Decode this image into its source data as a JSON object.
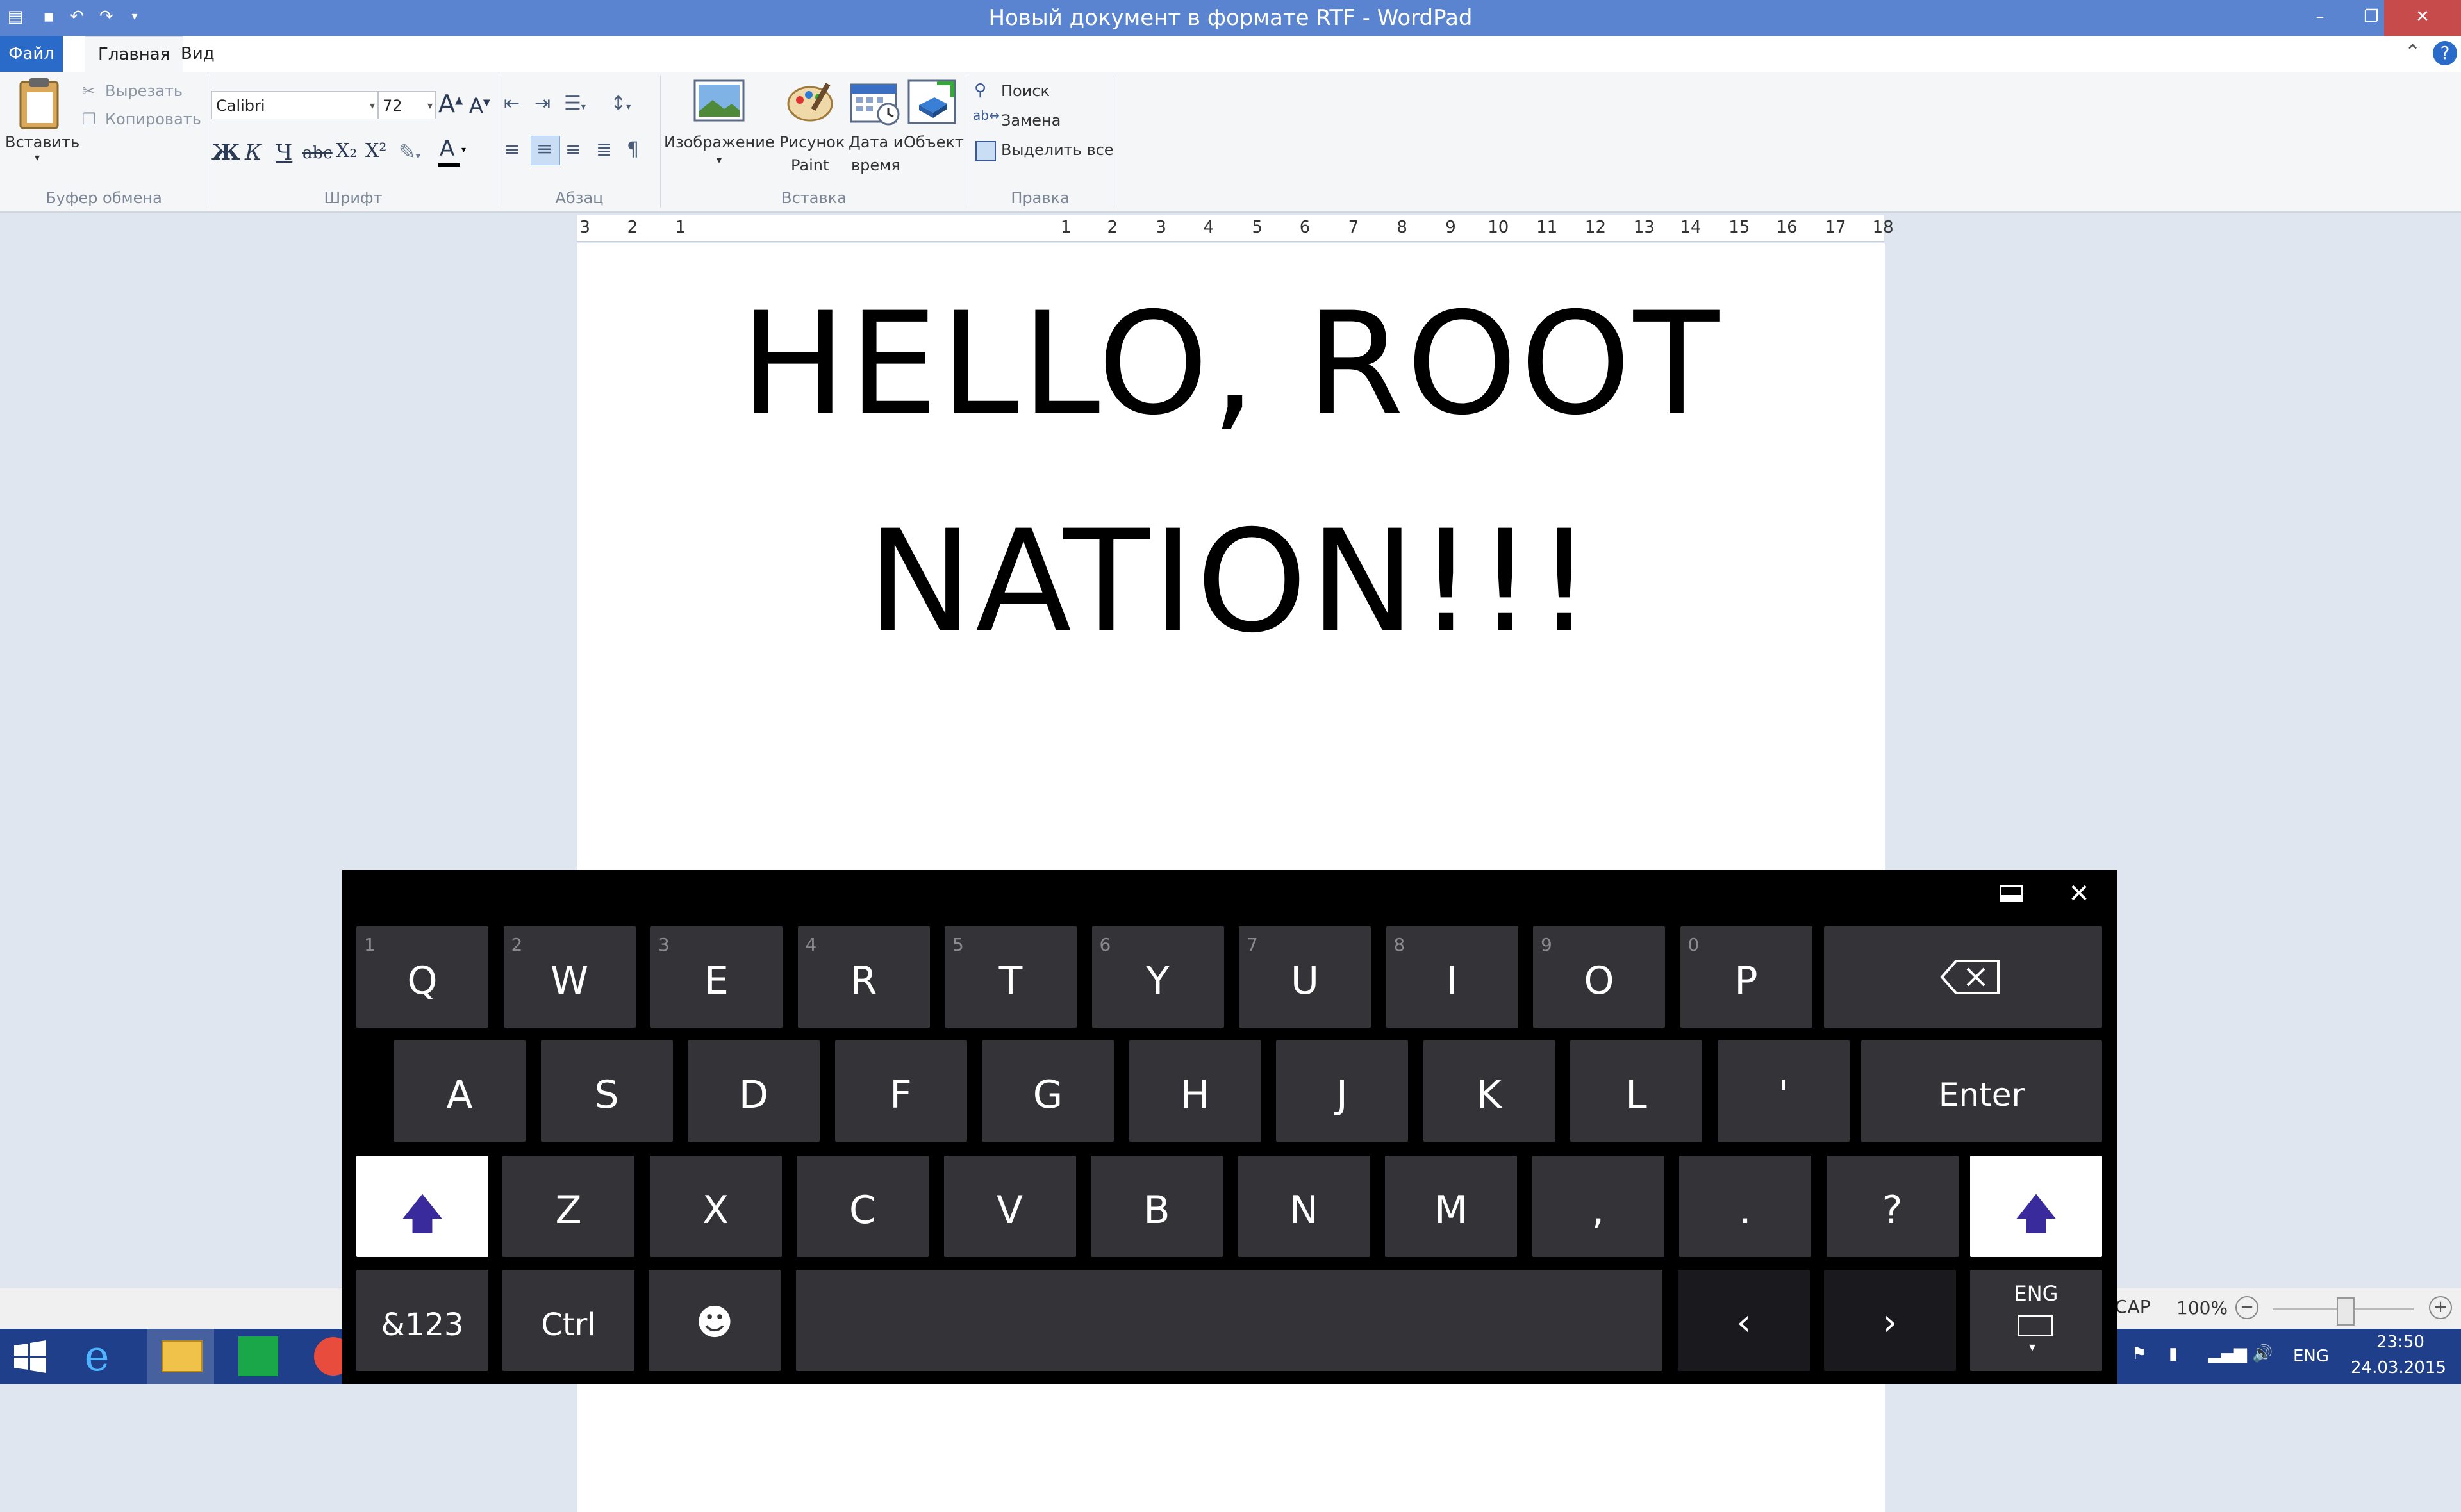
{
  "window": {
    "title": "Новый документ в формате RTF - WordPad"
  },
  "tabs": {
    "file": "Файл",
    "home": "Главная",
    "view": "Вид"
  },
  "clipboard": {
    "paste": "Вставить",
    "cut": "Вырезать",
    "copy": "Копировать",
    "group": "Буфер обмена"
  },
  "font": {
    "name": "Calibri",
    "size": "72",
    "group": "Шрифт",
    "bold": "Ж",
    "italic": "К",
    "underline": "Ч",
    "strike": "abc",
    "subscript": "X₂",
    "superscript": "X²"
  },
  "paragraph": {
    "group": "Абзац"
  },
  "insert": {
    "image": "Изображение",
    "paint1": "Рисунок",
    "paint2": "Paint",
    "datetime1": "Дата и",
    "datetime2": "время",
    "object": "Объект",
    "group": "Вставка"
  },
  "editing": {
    "find": "Поиск",
    "replace": "Замена",
    "select_all": "Выделить все",
    "group": "Правка"
  },
  "ruler": {
    "ticks": [
      "3",
      "2",
      "1",
      "1",
      "2",
      "3",
      "4",
      "5",
      "6",
      "7",
      "8",
      "9",
      "10",
      "11",
      "12",
      "13",
      "14",
      "15",
      "16",
      "17",
      "18"
    ]
  },
  "document": {
    "line1": "HELLO, ROOT",
    "line2": "NATION!!!"
  },
  "status": {
    "caps": "CAP",
    "zoom": "100%"
  },
  "tray": {
    "lang": "ENG",
    "time": "23:50",
    "date": "24.03.2015"
  },
  "keyboard": {
    "row1": [
      {
        "label": "Q",
        "num": "1"
      },
      {
        "label": "W",
        "num": "2"
      },
      {
        "label": "E",
        "num": "3"
      },
      {
        "label": "R",
        "num": "4"
      },
      {
        "label": "T",
        "num": "5"
      },
      {
        "label": "Y",
        "num": "6"
      },
      {
        "label": "U",
        "num": "7"
      },
      {
        "label": "I",
        "num": "8"
      },
      {
        "label": "O",
        "num": "9"
      },
      {
        "label": "P",
        "num": "0"
      }
    ],
    "row2": [
      "A",
      "S",
      "D",
      "F",
      "G",
      "H",
      "J",
      "K",
      "L",
      "'"
    ],
    "row3": [
      "Z",
      "X",
      "C",
      "V",
      "B",
      "N",
      "M",
      ",",
      ".",
      "?"
    ],
    "enter": "Enter",
    "numbers": "&123",
    "ctrl": "Ctrl",
    "lang": "ENG"
  }
}
